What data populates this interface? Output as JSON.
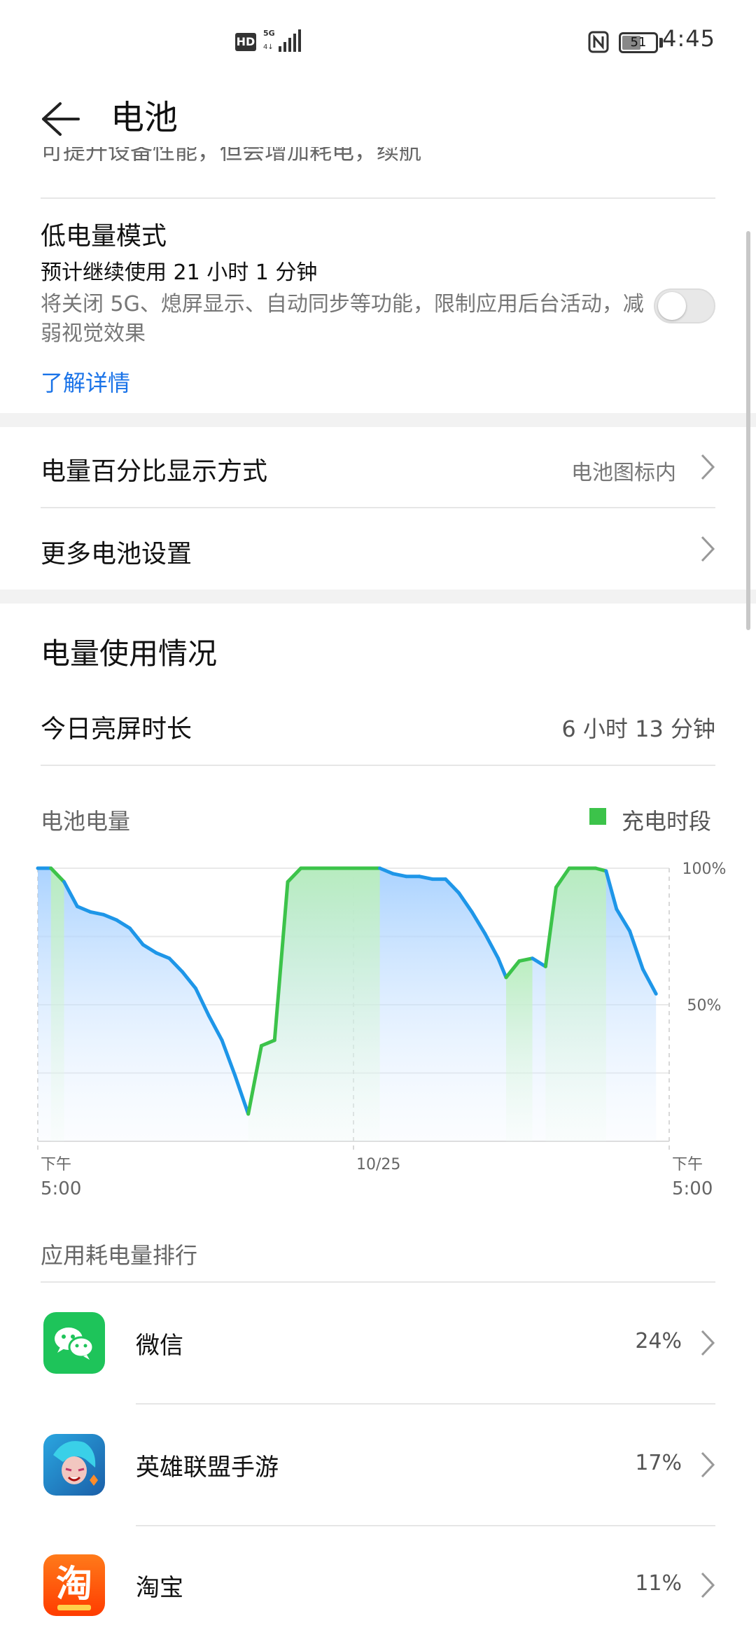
{
  "status_bar": {
    "hd": "HD",
    "network": "5G",
    "battery_level": "51",
    "time": "4:45"
  },
  "header": {
    "title": "电池"
  },
  "clipped_line": "可提升设备性能，但会增加耗电，续航",
  "low_power": {
    "title": "低电量模式",
    "estimate": "预计继续使用 21 小时 1 分钟",
    "description": "将关闭 5G、熄屏显示、自动同步等功能，限制应用后台活动，减弱视觉效果",
    "learn_more": "了解详情",
    "enabled": false
  },
  "settings": {
    "percentage_label": "电量百分比显示方式",
    "percentage_value": "电池图标内",
    "more_label": "更多电池设置"
  },
  "usage": {
    "section_title": "电量使用情况",
    "screen_time_label": "今日亮屏时长",
    "screen_time_value": "6 小时 13 分钟"
  },
  "chart_data": {
    "type": "area",
    "title": "电池电量",
    "legend": [
      "充电时段"
    ],
    "colors": {
      "discharge": "#1e96e8",
      "charge": "#3cc34a"
    },
    "y_ticks": [
      "100%",
      "50%"
    ],
    "ylim": [
      0,
      100
    ],
    "x_tick_labels": [
      {
        "line1": "下午",
        "line2": "5:00"
      },
      {
        "line1": "10/25",
        "line2": ""
      },
      {
        "line1": "下午",
        "line2": "5:00"
      }
    ],
    "x_range_hours": [
      0,
      24
    ],
    "points": [
      [
        0.0,
        100
      ],
      [
        0.5,
        100
      ],
      [
        1.0,
        95
      ],
      [
        1.5,
        86
      ],
      [
        2.0,
        84
      ],
      [
        2.5,
        83
      ],
      [
        3.0,
        81
      ],
      [
        3.5,
        78
      ],
      [
        4.0,
        72
      ],
      [
        4.5,
        69
      ],
      [
        5.0,
        67
      ],
      [
        5.5,
        62
      ],
      [
        6.0,
        56
      ],
      [
        6.5,
        46
      ],
      [
        7.0,
        37
      ],
      [
        7.5,
        24
      ],
      [
        8.0,
        10
      ],
      [
        8.5,
        35
      ],
      [
        9.0,
        37
      ],
      [
        9.5,
        95
      ],
      [
        10.0,
        100
      ],
      [
        13.0,
        100
      ],
      [
        13.5,
        98
      ],
      [
        14.0,
        97
      ],
      [
        14.5,
        97
      ],
      [
        15.0,
        96
      ],
      [
        15.5,
        96
      ],
      [
        16.0,
        91
      ],
      [
        16.5,
        84
      ],
      [
        17.0,
        76
      ],
      [
        17.5,
        67
      ],
      [
        17.8,
        60
      ],
      [
        18.3,
        66
      ],
      [
        18.8,
        67
      ],
      [
        19.3,
        64
      ],
      [
        19.7,
        93
      ],
      [
        20.2,
        100
      ],
      [
        21.2,
        100
      ],
      [
        21.6,
        99
      ],
      [
        22.0,
        85
      ],
      [
        22.5,
        77
      ],
      [
        23.0,
        63
      ],
      [
        23.5,
        54
      ]
    ],
    "charge_periods": [
      [
        0.5,
        1.0
      ],
      [
        8.0,
        13.0
      ],
      [
        17.8,
        18.8
      ],
      [
        19.3,
        21.6
      ]
    ]
  },
  "ranking": {
    "title": "应用耗电量排行",
    "apps": [
      {
        "name": "微信",
        "percent": "24%",
        "icon": "wechat-icon"
      },
      {
        "name": "英雄联盟手游",
        "percent": "17%",
        "icon": "league-of-legends-icon"
      },
      {
        "name": "淘宝",
        "percent": "11%",
        "icon": "taobao-icon",
        "icon_text": "淘"
      }
    ]
  }
}
